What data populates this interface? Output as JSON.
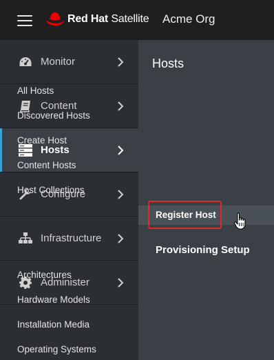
{
  "header": {
    "brand_bold": "Red Hat",
    "brand_product": "Satellite",
    "org": "Acme Org"
  },
  "sidebar": {
    "items": [
      {
        "label": "Monitor",
        "icon": "dashboard-gauge-icon",
        "active": false
      },
      {
        "label": "Content",
        "icon": "book-icon",
        "active": false
      },
      {
        "label": "Hosts",
        "icon": "server-stack-icon",
        "active": true
      },
      {
        "label": "Configure",
        "icon": "wrench-icon",
        "active": false
      },
      {
        "label": "Infrastructure",
        "icon": "network-icon",
        "active": false
      },
      {
        "label": "Administer",
        "icon": "gear-icon",
        "active": false
      }
    ]
  },
  "flyout": {
    "title": "Hosts",
    "items": [
      "All Hosts",
      "Discovered Hosts",
      "Create Host",
      "Content Hosts",
      "Host Collections",
      "Register Host"
    ],
    "group_header": "Provisioning Setup",
    "group_items": [
      "Architectures",
      "Hardware Models",
      "Installation Media",
      "Operating Systems"
    ]
  },
  "colors": {
    "header_bg": "#1f1f1f",
    "sidebar_bg": "#2b2f33",
    "flyout_bg": "#3b4047",
    "active_accent": "#39a5dc",
    "highlight_border": "#e02a2a",
    "brand_red": "#ee0000"
  }
}
